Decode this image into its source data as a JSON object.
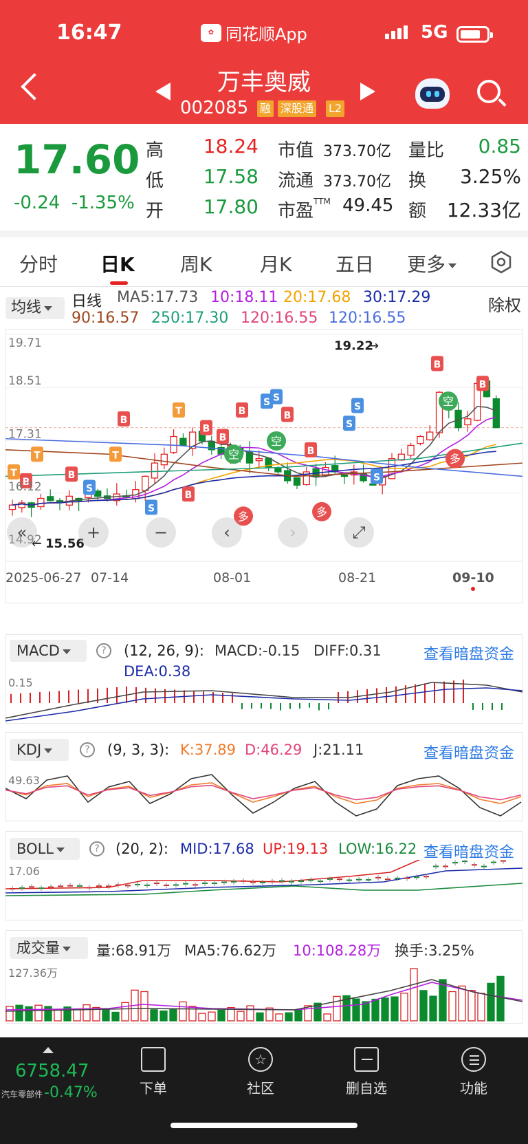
{
  "status": {
    "time": "16:47",
    "app": "同花顺App",
    "network": "5G"
  },
  "stock": {
    "name": "万丰奥威",
    "code": "002085",
    "tags": [
      "融",
      "深股通",
      "L2"
    ]
  },
  "quote": {
    "price": "17.60",
    "change": "-0.24",
    "change_pct": "-1.35%",
    "high_label": "高",
    "high": "18.24",
    "low_label": "低",
    "low": "17.58",
    "open_label": "开",
    "open": "17.80",
    "mktcap_label": "市值",
    "mktcap": "373.70亿",
    "float_label": "流通",
    "float": "373.70亿",
    "pe_label": "市盈",
    "pe_sup": "TTM",
    "pe": "49.45",
    "vr_label": "量比",
    "vr": "0.85",
    "turnover_label": "换",
    "turnover": "3.25%",
    "amount_label": "额",
    "amount": "12.33亿"
  },
  "tabs": [
    {
      "label": "分时",
      "active": false
    },
    {
      "label": "日K",
      "active": true
    },
    {
      "label": "周K",
      "active": false
    },
    {
      "label": "月K",
      "active": false
    },
    {
      "label": "五日",
      "active": false
    },
    {
      "label": "更多",
      "active": false
    }
  ],
  "kline": {
    "indicator_btn": "均线",
    "period": "日线",
    "ma": [
      {
        "text": "MA5:17.73",
        "color": "#555555"
      },
      {
        "text": "10:18.11",
        "color": "#b41ee0"
      },
      {
        "text": "20:17.68",
        "color": "#f0a400"
      },
      {
        "text": "30:17.29",
        "color": "#1b2aa8"
      },
      {
        "text": "90:16.57",
        "color": "#a0461e"
      },
      {
        "text": "250:17.30",
        "color": "#1d9d7a"
      },
      {
        "text": "120:16.55",
        "color": "#e0457b"
      },
      {
        "text": "120:16.55",
        "color": "#4a6de0"
      }
    ],
    "adjust": "除权",
    "y_labels": [
      "19.71",
      "18.51",
      "17.31",
      "16.12",
      "14.92"
    ],
    "high_mark": "19.22",
    "low_mark": "15.56",
    "dates": [
      "2025-06-27",
      "07-14",
      "08-01",
      "08-21",
      "09-10"
    ],
    "controls": [
      "«",
      "+",
      "−",
      "‹",
      "›",
      "⤢"
    ]
  },
  "macd": {
    "btn": "MACD",
    "params": "(12, 26, 9):",
    "macd": "MACD:-0.15",
    "diff": "DIFF:0.31",
    "dea": "DEA:0.38",
    "axis": "0.15",
    "link": "查看暗盘资金"
  },
  "kdj": {
    "btn": "KDJ",
    "params": "(9, 3, 3):",
    "k": "K:37.89",
    "d": "D:46.29",
    "j": "J:21.11",
    "axis": "49.63",
    "link": "查看暗盘资金"
  },
  "boll": {
    "btn": "BOLL",
    "params": "(20, 2):",
    "mid": "MID:17.68",
    "up": "UP:19.13",
    "low": "LOW:16.22",
    "axis": "17.06",
    "link": "查看暗盘资金"
  },
  "volume": {
    "btn": "成交量",
    "vol": "量:68.91万",
    "ma5": "MA5:76.62万",
    "ma10": "10:108.28万",
    "turnover": "换手:3.25%",
    "axis": "127.36万"
  },
  "bottom": {
    "index_value": "6758.47",
    "index_name": "汽车零部件",
    "index_change": "-0.47%",
    "items": [
      "下单",
      "社区",
      "删自选",
      "功能"
    ]
  }
}
